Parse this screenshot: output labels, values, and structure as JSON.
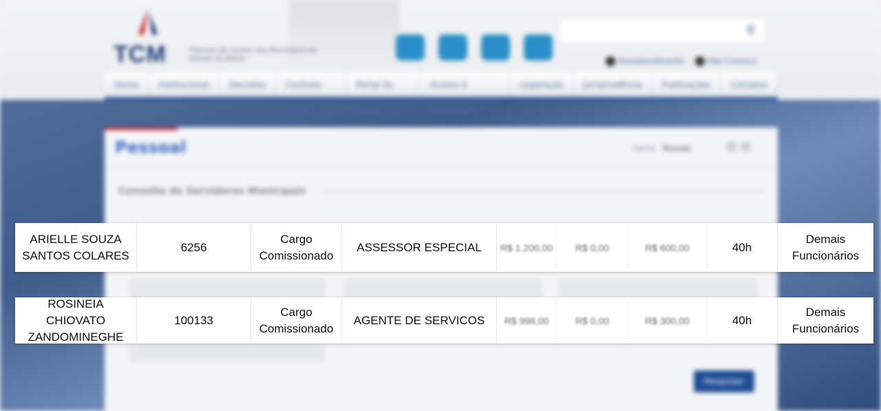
{
  "site": {
    "logo_text": "TCM",
    "logo_subtitle": "Tribunal de Contas dos Municípios do Estado da Bahia",
    "util_links": [
      "Autoatendimento",
      "Fale Conosco"
    ],
    "nav": [
      "Home",
      "Institucional",
      "Decisões",
      "Controle Social",
      "Portal do Gestor",
      "Acesso à Informação",
      "Legislação",
      "Jurisprudência",
      "Publicações",
      "Contatos"
    ]
  },
  "page": {
    "title": "Pessoal",
    "breadcrumb": [
      "Home",
      "Pessoal"
    ],
    "section_title": "Consulta de Servidores Municipais",
    "submit_label": "Pesquisar"
  },
  "results": [
    {
      "nome": "ARIELLE SOUZA SANTOS COLARES",
      "matricula": "6256",
      "tipo_servidor": "Cargo Comissionado",
      "cargo": "ASSESSOR ESPECIAL",
      "salario_base": "R$ 1.200,00",
      "valor_2": "R$ 0,00",
      "valor_3": "R$ 600,00",
      "carga_horaria": "40h",
      "categoria": "Demais Funcionários"
    },
    {
      "nome": "ROSINEIA CHIOVATO ZANDOMINEGHE",
      "matricula": "100133",
      "tipo_servidor": "Cargo Comissionado",
      "cargo": "AGENTE DE SERVICOS",
      "salario_base": "R$ 998,00",
      "valor_2": "R$ 0,00",
      "valor_3": "R$ 300,00",
      "carga_horaria": "40h",
      "categoria": "Demais Funcionários"
    }
  ],
  "colors": {
    "brand_blue": "#1c3a78",
    "nav_border": "#1c4e96",
    "accent_red": "#c4272e"
  }
}
